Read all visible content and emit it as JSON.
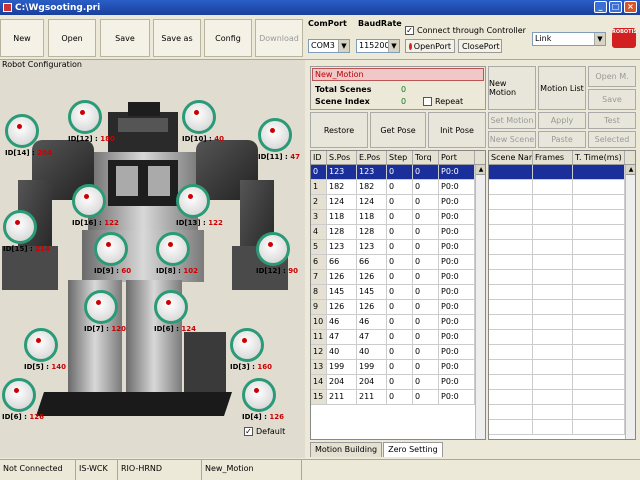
{
  "window": {
    "title": "C:\\Wgsooting.pri"
  },
  "toolbar": {
    "buttons": [
      "New",
      "Open",
      "Save",
      "Save as",
      "Config",
      "Download"
    ],
    "comport_label": "ComPort",
    "baudrate_label": "BaudRate",
    "comport_value": "COM3",
    "baudrate_value": "115200",
    "connect_through_label": "Connect through Controller",
    "openport_label": "OpenPort",
    "closeport_label": "ClosePort",
    "link_value": "Link",
    "logo_text": "ROBOTIS"
  },
  "left": {
    "title": "Robot Configuration",
    "default_label": "Default",
    "motors": [
      {
        "label": "ID[14] : ",
        "value": "204"
      },
      {
        "label": "ID[12] : ",
        "value": "180"
      },
      {
        "label": "ID[10] : ",
        "value": "40"
      },
      {
        "label": "ID[11] : ",
        "value": "47"
      },
      {
        "label": "ID[16] : ",
        "value": "122"
      },
      {
        "label": "ID[15] : ",
        "value": "101"
      },
      {
        "label": "ID[13] : ",
        "value": "122"
      },
      {
        "label": "ID[15] : ",
        "value": "214"
      },
      {
        "label": "ID[9] : ",
        "value": "60"
      },
      {
        "label": "ID[8] : ",
        "value": "102"
      },
      {
        "label": "ID[12] : ",
        "value": "90"
      },
      {
        "label": "ID[7] : ",
        "value": "120"
      },
      {
        "label": "ID[6] : ",
        "value": "124"
      },
      {
        "label": "ID[5] : ",
        "value": "140"
      },
      {
        "label": "ID[3] : ",
        "value": "160"
      },
      {
        "label": "ID[6] : ",
        "value": "126"
      },
      {
        "label": "ID[4] : ",
        "value": "126"
      }
    ]
  },
  "motion": {
    "name": "New_Motion",
    "total_scenes_label": "Total Scenes",
    "total_scenes": "0",
    "scene_index_label": "Scene Index",
    "scene_index": "0",
    "repeat_label": "Repeat",
    "buttons": [
      "New Motion",
      "Motion List",
      "Open M.",
      "Save"
    ],
    "restore_label": "Restore",
    "getpose_label": "Get Pose",
    "initpose_label": "Init Pose",
    "scene_buttons": [
      "Set Motion",
      "Apply",
      "Test",
      "New Scene",
      "Paste",
      "Selected"
    ],
    "grid": {
      "headers": [
        "ID",
        "S.Pos",
        "E.Pos",
        "Step",
        "Torq",
        "Port"
      ],
      "rows": [
        [
          "0",
          "123",
          "123",
          "0",
          "0",
          "P0:0"
        ],
        [
          "1",
          "182",
          "182",
          "0",
          "0",
          "P0:0"
        ],
        [
          "2",
          "124",
          "124",
          "0",
          "0",
          "P0:0"
        ],
        [
          "3",
          "118",
          "118",
          "0",
          "0",
          "P0:0"
        ],
        [
          "4",
          "128",
          "128",
          "0",
          "0",
          "P0:0"
        ],
        [
          "5",
          "123",
          "123",
          "0",
          "0",
          "P0:0"
        ],
        [
          "6",
          "66",
          "66",
          "0",
          "0",
          "P0:0"
        ],
        [
          "7",
          "126",
          "126",
          "0",
          "0",
          "P0:0"
        ],
        [
          "8",
          "145",
          "145",
          "0",
          "0",
          "P0:0"
        ],
        [
          "9",
          "126",
          "126",
          "0",
          "0",
          "P0:0"
        ],
        [
          "10",
          "46",
          "46",
          "0",
          "0",
          "P0:0"
        ],
        [
          "11",
          "47",
          "47",
          "0",
          "0",
          "P0:0"
        ],
        [
          "12",
          "40",
          "40",
          "0",
          "0",
          "P0:0"
        ],
        [
          "13",
          "199",
          "199",
          "0",
          "0",
          "P0:0"
        ],
        [
          "14",
          "204",
          "204",
          "0",
          "0",
          "P0:0"
        ],
        [
          "15",
          "211",
          "211",
          "0",
          "0",
          "P0:0"
        ]
      ]
    },
    "scene_grid": {
      "headers": [
        "Scene Name",
        "Frames",
        "T. Time(ms)"
      ]
    },
    "tabs": [
      "Motion Building",
      "Zero Setting"
    ]
  },
  "status": [
    "Not Connected",
    "IS-WCK",
    "RIO-HRND",
    "New_Motion"
  ]
}
